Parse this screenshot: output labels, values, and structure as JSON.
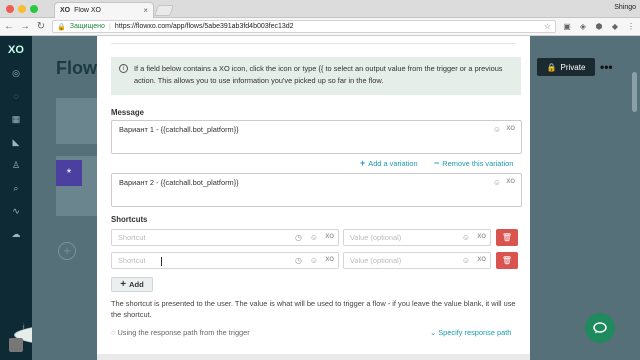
{
  "browser": {
    "tab_title": "Flow XO",
    "tab_favicon": "XO",
    "user": "Shingo",
    "secure_label": "Защищено",
    "url": "https://flowxo.com/app/flows/5abe391ab3fd4b003fec13d2"
  },
  "background_app": {
    "page_title": "Flows",
    "privacy_label": "Private"
  },
  "modal": {
    "info_text": "If a field below contains a XO icon, click the icon or type {{ to select an output value from the trigger or a previous action. This allows you to use information you've picked up so far in the flow.",
    "message_label": "Message",
    "variants": [
      "Вариант 1 - {{catchall.bot_platform}}",
      "Вариант 2 - {{catchall.bot_platform}}"
    ],
    "add_variation": "Add a variation",
    "remove_variation": "Remove this variation",
    "shortcuts_label": "Shortcuts",
    "shortcut_placeholder": "Shortcut",
    "value_placeholder": "Value (optional)",
    "add_button": "Add",
    "help_text": "The shortcut is presented to the user. The value is what will be used to trigger a flow - if you leave the value blank, it will use the shortcut.",
    "response_path_note": "Using the response path from the trigger",
    "specify_response_path": "Specify response path"
  },
  "colors": {
    "accent": "#1a9bb2",
    "danger": "#d9534f",
    "sidebar": "#0d2a35",
    "chat": "#1f8a5e"
  }
}
